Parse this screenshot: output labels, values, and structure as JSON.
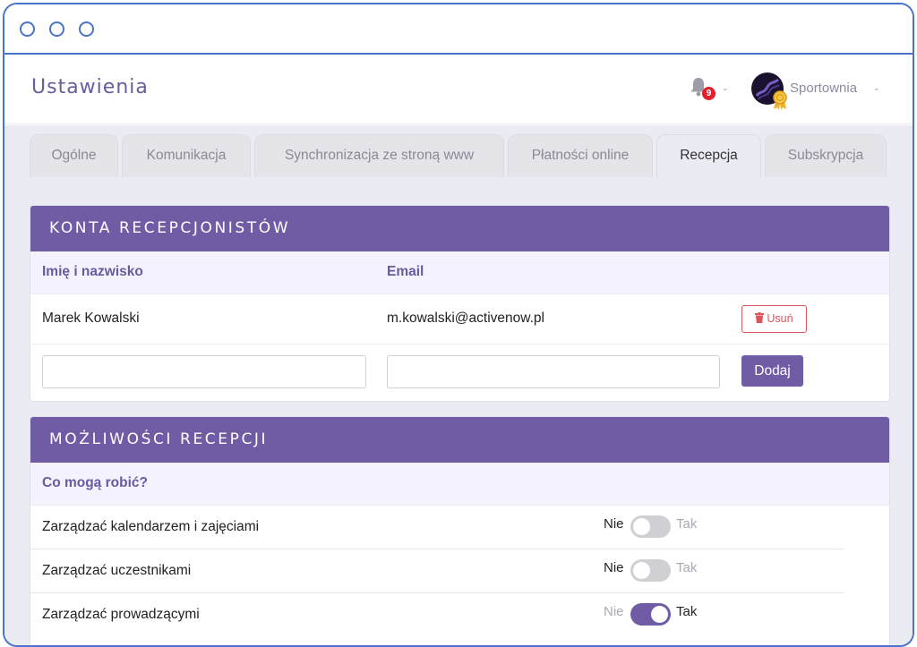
{
  "page": {
    "title": "Ustawienia"
  },
  "notifications": {
    "count": "9"
  },
  "profile": {
    "name": "Sportownia"
  },
  "tabs": [
    {
      "label": "Ogólne"
    },
    {
      "label": "Komunikacja"
    },
    {
      "label": "Synchronizacja ze stroną www"
    },
    {
      "label": "Płatności online"
    },
    {
      "label": "Recepcja"
    },
    {
      "label": "Subskrypcja"
    }
  ],
  "active_tab": "Recepcja",
  "accounts": {
    "header": "KONTA RECEPCJONISTÓW",
    "col_name": "Imię i nazwisko",
    "col_email": "Email",
    "rows": [
      {
        "name": "Marek Kowalski",
        "email": "m.kowalski@activenow.pl",
        "remove_label": "Usuń"
      }
    ],
    "name_input": {
      "value": ""
    },
    "email_input": {
      "value": ""
    },
    "add_label": "Dodaj"
  },
  "permissions": {
    "header": "MOŻLIWOŚCI RECEPCJI",
    "subheader": "Co mogą robić?",
    "no_label": "Nie",
    "yes_label": "Tak",
    "items": [
      {
        "label": "Zarządzać kalendarzem i zajęciami",
        "enabled": false
      },
      {
        "label": "Zarządzać uczestnikami",
        "enabled": false
      },
      {
        "label": "Zarządzać prowadzącymi",
        "enabled": true
      }
    ]
  },
  "colors": {
    "accent": "#6f5ca5",
    "window_border": "#4a74c9",
    "danger": "#e0525c",
    "badge": "#e0202f",
    "content_bg": "#ebebf3"
  }
}
